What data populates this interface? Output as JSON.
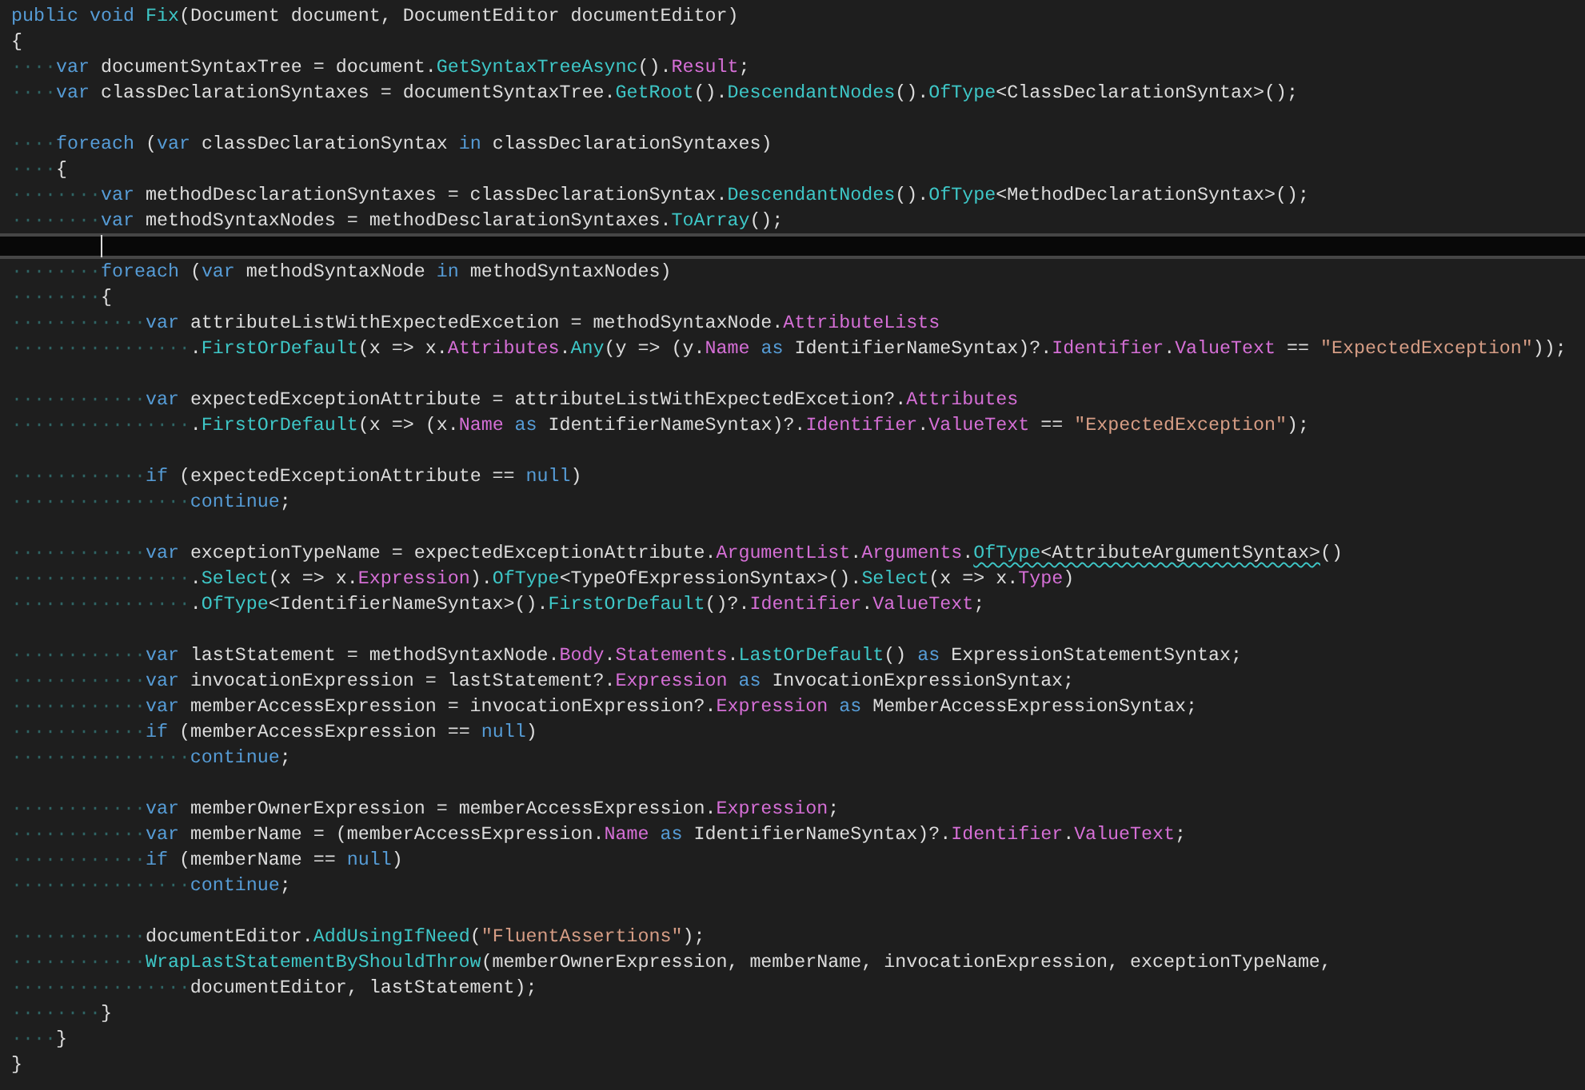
{
  "editor": {
    "lines": [
      {
        "current": false,
        "tokens": [
          {
            "kind": "kw",
            "text": "public void "
          },
          {
            "kind": "call",
            "text": "Fix"
          },
          {
            "kind": "text",
            "text": "(Document document, DocumentEditor documentEditor)"
          }
        ]
      },
      {
        "current": false,
        "tokens": [
          {
            "kind": "text",
            "text": "{"
          }
        ]
      },
      {
        "current": false,
        "tokens": [
          {
            "kind": "ws",
            "text": "····"
          },
          {
            "kind": "kw",
            "text": "var "
          },
          {
            "kind": "text",
            "text": "documentSyntaxTree = document."
          },
          {
            "kind": "call",
            "text": "GetSyntaxTreeAsync"
          },
          {
            "kind": "text",
            "text": "()."
          },
          {
            "kind": "prop",
            "text": "Result"
          },
          {
            "kind": "text",
            "text": ";"
          }
        ]
      },
      {
        "current": false,
        "tokens": [
          {
            "kind": "ws",
            "text": "····"
          },
          {
            "kind": "kw",
            "text": "var "
          },
          {
            "kind": "text",
            "text": "classDeclarationSyntaxes = documentSyntaxTree."
          },
          {
            "kind": "call",
            "text": "GetRoot"
          },
          {
            "kind": "text",
            "text": "()."
          },
          {
            "kind": "call",
            "text": "DescendantNodes"
          },
          {
            "kind": "text",
            "text": "()."
          },
          {
            "kind": "call",
            "text": "OfType"
          },
          {
            "kind": "text",
            "text": "<ClassDeclarationSyntax>();"
          }
        ]
      },
      {
        "current": false
      },
      {
        "current": false,
        "tokens": [
          {
            "kind": "ws",
            "text": "····"
          },
          {
            "kind": "kw",
            "text": "foreach "
          },
          {
            "kind": "text",
            "text": "("
          },
          {
            "kind": "kw",
            "text": "var "
          },
          {
            "kind": "text",
            "text": "classDeclarationSyntax "
          },
          {
            "kind": "kw",
            "text": "in "
          },
          {
            "kind": "text",
            "text": "classDeclarationSyntaxes)"
          }
        ]
      },
      {
        "current": false,
        "tokens": [
          {
            "kind": "ws",
            "text": "····"
          },
          {
            "kind": "text",
            "text": "{"
          }
        ]
      },
      {
        "current": false,
        "tokens": [
          {
            "kind": "ws",
            "text": "········"
          },
          {
            "kind": "kw",
            "text": "var "
          },
          {
            "kind": "text",
            "text": "methodDesclarationSyntaxes = classDeclarationSyntax."
          },
          {
            "kind": "call",
            "text": "DescendantNodes"
          },
          {
            "kind": "text",
            "text": "()."
          },
          {
            "kind": "call",
            "text": "OfType"
          },
          {
            "kind": "text",
            "text": "<MethodDeclarationSyntax>();"
          }
        ]
      },
      {
        "current": false,
        "tokens": [
          {
            "kind": "ws",
            "text": "········"
          },
          {
            "kind": "kw",
            "text": "var "
          },
          {
            "kind": "text",
            "text": "methodSyntaxNodes = methodDesclarationSyntaxes."
          },
          {
            "kind": "call",
            "text": "ToArray"
          },
          {
            "kind": "text",
            "text": "();"
          }
        ]
      },
      {
        "current": true
      },
      {
        "current": false,
        "tokens": [
          {
            "kind": "ws",
            "text": "········"
          },
          {
            "kind": "kw",
            "text": "foreach "
          },
          {
            "kind": "text",
            "text": "("
          },
          {
            "kind": "kw",
            "text": "var "
          },
          {
            "kind": "text",
            "text": "methodSyntaxNode "
          },
          {
            "kind": "kw",
            "text": "in "
          },
          {
            "kind": "text",
            "text": "methodSyntaxNodes)"
          }
        ]
      },
      {
        "current": false,
        "tokens": [
          {
            "kind": "ws",
            "text": "········"
          },
          {
            "kind": "text",
            "text": "{"
          }
        ]
      },
      {
        "current": false,
        "tokens": [
          {
            "kind": "ws",
            "text": "············"
          },
          {
            "kind": "kw",
            "text": "var "
          },
          {
            "kind": "text",
            "text": "attributeListWithExpectedExcetion = methodSyntaxNode."
          },
          {
            "kind": "prop",
            "text": "AttributeLists"
          }
        ]
      },
      {
        "current": false,
        "tokens": [
          {
            "kind": "ws",
            "text": "················"
          },
          {
            "kind": "text",
            "text": "."
          },
          {
            "kind": "call",
            "text": "FirstOrDefault"
          },
          {
            "kind": "text",
            "text": "(x => x."
          },
          {
            "kind": "prop",
            "text": "Attributes"
          },
          {
            "kind": "text",
            "text": "."
          },
          {
            "kind": "call",
            "text": "Any"
          },
          {
            "kind": "text",
            "text": "(y => (y."
          },
          {
            "kind": "prop",
            "text": "Name"
          },
          {
            "kind": "kw",
            "text": " as "
          },
          {
            "kind": "text",
            "text": "IdentifierNameSyntax)?."
          },
          {
            "kind": "prop",
            "text": "Identifier"
          },
          {
            "kind": "text",
            "text": "."
          },
          {
            "kind": "prop",
            "text": "ValueText"
          },
          {
            "kind": "text",
            "text": " == "
          },
          {
            "kind": "str",
            "text": "\"ExpectedException\""
          },
          {
            "kind": "text",
            "text": "));"
          }
        ]
      },
      {
        "current": false
      },
      {
        "current": false,
        "tokens": [
          {
            "kind": "ws",
            "text": "············"
          },
          {
            "kind": "kw",
            "text": "var "
          },
          {
            "kind": "text",
            "text": "expectedExceptionAttribute = attributeListWithExpectedExcetion?."
          },
          {
            "kind": "prop",
            "text": "Attributes"
          }
        ]
      },
      {
        "current": false,
        "tokens": [
          {
            "kind": "ws",
            "text": "················"
          },
          {
            "kind": "text",
            "text": "."
          },
          {
            "kind": "call",
            "text": "FirstOrDefault"
          },
          {
            "kind": "text",
            "text": "(x => (x."
          },
          {
            "kind": "prop",
            "text": "Name"
          },
          {
            "kind": "kw",
            "text": " as "
          },
          {
            "kind": "text",
            "text": "IdentifierNameSyntax)?."
          },
          {
            "kind": "prop",
            "text": "Identifier"
          },
          {
            "kind": "text",
            "text": "."
          },
          {
            "kind": "prop",
            "text": "ValueText"
          },
          {
            "kind": "text",
            "text": " == "
          },
          {
            "kind": "str",
            "text": "\"ExpectedException\""
          },
          {
            "kind": "text",
            "text": ");"
          }
        ]
      },
      {
        "current": false
      },
      {
        "current": false,
        "tokens": [
          {
            "kind": "ws",
            "text": "············"
          },
          {
            "kind": "kw",
            "text": "if "
          },
          {
            "kind": "text",
            "text": "(expectedExceptionAttribute == "
          },
          {
            "kind": "kw",
            "text": "null"
          },
          {
            "kind": "text",
            "text": ")"
          }
        ]
      },
      {
        "current": false,
        "tokens": [
          {
            "kind": "ws",
            "text": "················"
          },
          {
            "kind": "kw",
            "text": "continue"
          },
          {
            "kind": "text",
            "text": ";"
          }
        ]
      },
      {
        "current": false
      },
      {
        "current": false,
        "tokens": [
          {
            "kind": "ws",
            "text": "············"
          },
          {
            "kind": "kw",
            "text": "var "
          },
          {
            "kind": "text",
            "text": "exceptionTypeName = expectedExceptionAttribute."
          },
          {
            "kind": "prop",
            "text": "ArgumentList"
          },
          {
            "kind": "text",
            "text": "."
          },
          {
            "kind": "prop",
            "text": "Arguments"
          },
          {
            "kind": "text",
            "text": "."
          },
          {
            "kind": "call-warn",
            "text": "OfType"
          },
          {
            "kind": "text-warn",
            "text": "<AttributeArgumentSyntax>"
          },
          {
            "kind": "text",
            "text": "()"
          }
        ]
      },
      {
        "current": false,
        "tokens": [
          {
            "kind": "ws",
            "text": "················"
          },
          {
            "kind": "text",
            "text": "."
          },
          {
            "kind": "call",
            "text": "Select"
          },
          {
            "kind": "text",
            "text": "(x => x."
          },
          {
            "kind": "prop",
            "text": "Expression"
          },
          {
            "kind": "text",
            "text": ")."
          },
          {
            "kind": "call",
            "text": "OfType"
          },
          {
            "kind": "text",
            "text": "<TypeOfExpressionSyntax>()."
          },
          {
            "kind": "call",
            "text": "Select"
          },
          {
            "kind": "text",
            "text": "(x => x."
          },
          {
            "kind": "prop",
            "text": "Type"
          },
          {
            "kind": "text",
            "text": ")"
          }
        ]
      },
      {
        "current": false,
        "tokens": [
          {
            "kind": "ws",
            "text": "················"
          },
          {
            "kind": "text",
            "text": "."
          },
          {
            "kind": "call",
            "text": "OfType"
          },
          {
            "kind": "text",
            "text": "<IdentifierNameSyntax>()."
          },
          {
            "kind": "call",
            "text": "FirstOrDefault"
          },
          {
            "kind": "text",
            "text": "()?."
          },
          {
            "kind": "prop",
            "text": "Identifier"
          },
          {
            "kind": "text",
            "text": "."
          },
          {
            "kind": "prop",
            "text": "ValueText"
          },
          {
            "kind": "text",
            "text": ";"
          }
        ]
      },
      {
        "current": false
      },
      {
        "current": false,
        "tokens": [
          {
            "kind": "ws",
            "text": "············"
          },
          {
            "kind": "kw",
            "text": "var "
          },
          {
            "kind": "text",
            "text": "lastStatement = methodSyntaxNode."
          },
          {
            "kind": "prop",
            "text": "Body"
          },
          {
            "kind": "text",
            "text": "."
          },
          {
            "kind": "prop",
            "text": "Statements"
          },
          {
            "kind": "text",
            "text": "."
          },
          {
            "kind": "call",
            "text": "LastOrDefault"
          },
          {
            "kind": "text",
            "text": "() "
          },
          {
            "kind": "kw",
            "text": "as "
          },
          {
            "kind": "text",
            "text": "ExpressionStatementSyntax;"
          }
        ]
      },
      {
        "current": false,
        "tokens": [
          {
            "kind": "ws",
            "text": "············"
          },
          {
            "kind": "kw",
            "text": "var "
          },
          {
            "kind": "text",
            "text": "invocationExpression = lastStatement?."
          },
          {
            "kind": "prop",
            "text": "Expression"
          },
          {
            "kind": "kw",
            "text": " as "
          },
          {
            "kind": "text",
            "text": "InvocationExpressionSyntax;"
          }
        ]
      },
      {
        "current": false,
        "tokens": [
          {
            "kind": "ws",
            "text": "············"
          },
          {
            "kind": "kw",
            "text": "var "
          },
          {
            "kind": "text",
            "text": "memberAccessExpression = invocationExpression?."
          },
          {
            "kind": "prop",
            "text": "Expression"
          },
          {
            "kind": "kw",
            "text": " as "
          },
          {
            "kind": "text",
            "text": "MemberAccessExpressionSyntax;"
          }
        ]
      },
      {
        "current": false,
        "tokens": [
          {
            "kind": "ws",
            "text": "············"
          },
          {
            "kind": "kw",
            "text": "if "
          },
          {
            "kind": "text",
            "text": "(memberAccessExpression == "
          },
          {
            "kind": "kw",
            "text": "null"
          },
          {
            "kind": "text",
            "text": ")"
          }
        ]
      },
      {
        "current": false,
        "tokens": [
          {
            "kind": "ws",
            "text": "················"
          },
          {
            "kind": "kw",
            "text": "continue"
          },
          {
            "kind": "text",
            "text": ";"
          }
        ]
      },
      {
        "current": false
      },
      {
        "current": false,
        "tokens": [
          {
            "kind": "ws",
            "text": "············"
          },
          {
            "kind": "kw",
            "text": "var "
          },
          {
            "kind": "text",
            "text": "memberOwnerExpression = memberAccessExpression."
          },
          {
            "kind": "prop",
            "text": "Expression"
          },
          {
            "kind": "text",
            "text": ";"
          }
        ]
      },
      {
        "current": false,
        "tokens": [
          {
            "kind": "ws",
            "text": "············"
          },
          {
            "kind": "kw",
            "text": "var "
          },
          {
            "kind": "text",
            "text": "memberName = (memberAccessExpression."
          },
          {
            "kind": "prop",
            "text": "Name"
          },
          {
            "kind": "kw",
            "text": " as "
          },
          {
            "kind": "text",
            "text": "IdentifierNameSyntax)?."
          },
          {
            "kind": "prop",
            "text": "Identifier"
          },
          {
            "kind": "text",
            "text": "."
          },
          {
            "kind": "prop",
            "text": "ValueText"
          },
          {
            "kind": "text",
            "text": ";"
          }
        ]
      },
      {
        "current": false,
        "tokens": [
          {
            "kind": "ws",
            "text": "············"
          },
          {
            "kind": "kw",
            "text": "if "
          },
          {
            "kind": "text",
            "text": "(memberName == "
          },
          {
            "kind": "kw",
            "text": "null"
          },
          {
            "kind": "text",
            "text": ")"
          }
        ]
      },
      {
        "current": false,
        "tokens": [
          {
            "kind": "ws",
            "text": "················"
          },
          {
            "kind": "kw",
            "text": "continue"
          },
          {
            "kind": "text",
            "text": ";"
          }
        ]
      },
      {
        "current": false
      },
      {
        "current": false,
        "tokens": [
          {
            "kind": "ws",
            "text": "············"
          },
          {
            "kind": "text",
            "text": "documentEditor."
          },
          {
            "kind": "call",
            "text": "AddUsingIfNeed"
          },
          {
            "kind": "text",
            "text": "("
          },
          {
            "kind": "str",
            "text": "\"FluentAssertions\""
          },
          {
            "kind": "text",
            "text": ");"
          }
        ]
      },
      {
        "current": false,
        "tokens": [
          {
            "kind": "ws",
            "text": "············"
          },
          {
            "kind": "call",
            "text": "WrapLastStatementByShouldThrow"
          },
          {
            "kind": "text",
            "text": "(memberOwnerExpression, memberName, invocationExpression, exceptionTypeName,"
          }
        ]
      },
      {
        "current": false,
        "tokens": [
          {
            "kind": "ws",
            "text": "················"
          },
          {
            "kind": "text",
            "text": "documentEditor, lastStatement);"
          }
        ]
      },
      {
        "current": false,
        "tokens": [
          {
            "kind": "ws",
            "text": "········"
          },
          {
            "kind": "text",
            "text": "}"
          }
        ]
      },
      {
        "current": false,
        "tokens": [
          {
            "kind": "ws",
            "text": "····"
          },
          {
            "kind": "text",
            "text": "}"
          }
        ]
      },
      {
        "current": false,
        "tokens": [
          {
            "kind": "text",
            "text": "}"
          }
        ]
      }
    ]
  }
}
